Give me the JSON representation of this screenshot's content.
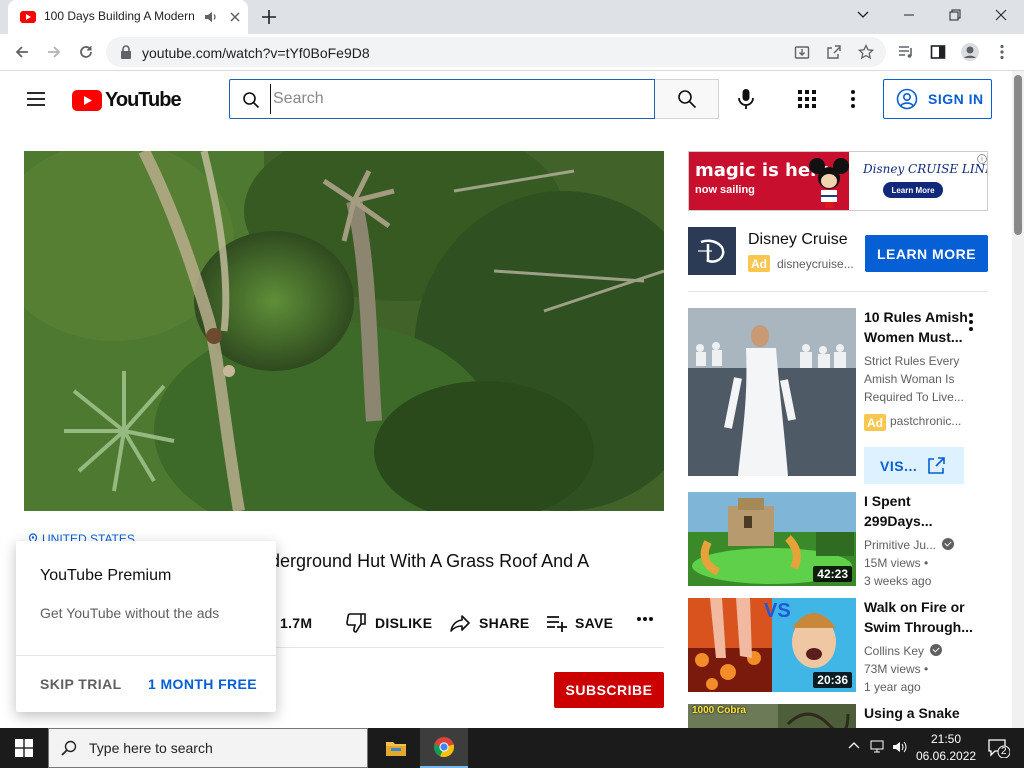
{
  "browser": {
    "tab": {
      "title": "100 Days Building A Modern",
      "audio_icon": "speaker-icon",
      "close_icon": "close-icon"
    },
    "new_tab_icon": "plus-icon",
    "window_controls": [
      "chevron-down-icon",
      "minimize-icon",
      "restore-icon",
      "close-icon"
    ],
    "url": "youtube.com/watch?v=tYf0BoFe9D8",
    "toolbar_icons": [
      "back-icon",
      "forward-icon",
      "reload-icon",
      "lock-icon",
      "install-icon",
      "share-icon",
      "star-icon",
      "media-icon",
      "sidepanel-icon",
      "profile-icon",
      "kebab-icon"
    ]
  },
  "masthead": {
    "logo_text": "YouTube",
    "search_placeholder": "Search",
    "signin_label": "SIGN IN"
  },
  "video": {
    "location": "UNITED STATES",
    "title_visible": "derground Hut With A Grass Roof And A",
    "actions": [
      {
        "label": "1.7M",
        "icon": "thumbs-up-icon"
      },
      {
        "label": "DISLIKE",
        "icon": "thumbs-down-icon"
      },
      {
        "label": "SHARE",
        "icon": "share-arrow-icon"
      },
      {
        "label": "SAVE",
        "icon": "playlist-add-icon"
      }
    ],
    "subscribe_label": "SUBSCRIBE"
  },
  "premium_popup": {
    "title": "YouTube Premium",
    "description": "Get YouTube without the ads",
    "skip_label": "SKIP TRIAL",
    "cta_label": "1 MONTH FREE"
  },
  "sidebar": {
    "banner_ad": {
      "headline": "magic is here",
      "subline": "now sailing",
      "brand": "Disney CRUISE LINE",
      "button": "Learn More"
    },
    "promo": {
      "name": "Disney Cruise",
      "ad_badge": "Ad",
      "domain": "disneycruise...",
      "cta": "LEARN MORE"
    },
    "recommendations": [
      {
        "title": "10 Rules Amish Women Must...",
        "description": "Strict Rules Every Amish Woman Is Required To Live...",
        "ad_badge": "Ad",
        "channel": "pastchronic...",
        "cta": "VIS..."
      },
      {
        "title": "I Spent 299Days...",
        "channel": "Primitive Ju...",
        "views": "15M views",
        "age": "3 weeks ago",
        "duration": "42:23"
      },
      {
        "title": "Walk on Fire or Swim Through...",
        "channel": "Collins Key",
        "views": "73M views",
        "age": "1 year ago",
        "duration": "20:36",
        "thumb_badge": "VS"
      },
      {
        "title": "Using a Snake",
        "thumb_badge": "1000 Cobra"
      }
    ]
  },
  "taskbar": {
    "search_placeholder": "Type here to search",
    "time": "21:50",
    "date": "06.06.2022",
    "notification_count": "2"
  },
  "colors": {
    "youtube_red": "#ff0000",
    "link_blue": "#065fd4",
    "subscribe_red": "#cc0000",
    "ad_yellow": "#f9c74f"
  }
}
